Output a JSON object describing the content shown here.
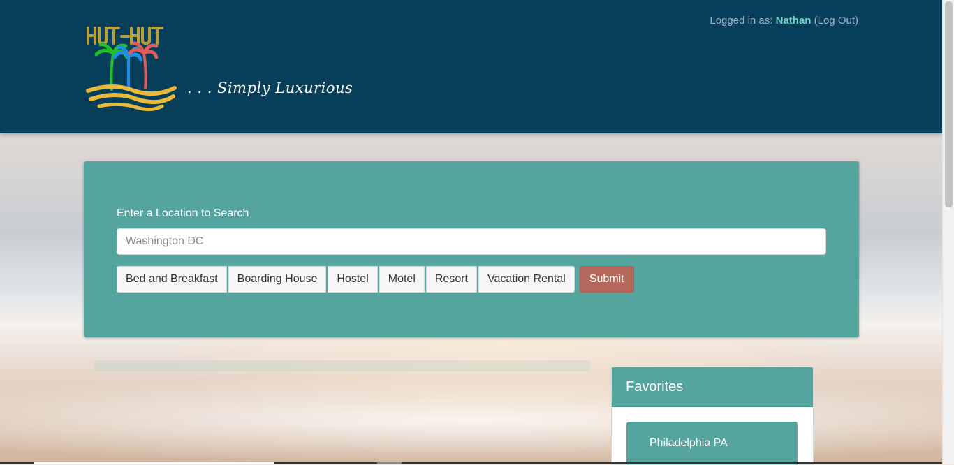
{
  "header": {
    "logo_icon": "palm-trees-logo",
    "tagline": ". . . Simply Luxurious",
    "login_prefix": "Logged in as:",
    "username": "Nathan",
    "logout_label": "(Log Out)"
  },
  "search": {
    "label": "Enter a Location to Search",
    "value": "",
    "placeholder": "Washington DC",
    "types": [
      "Bed and Breakfast",
      "Boarding House",
      "Hostel",
      "Motel",
      "Resort",
      "Vacation Rental"
    ],
    "submit_label": "Submit"
  },
  "favorites": {
    "title": "Favorites",
    "items": [
      "Philadelphia PA"
    ]
  },
  "colors": {
    "header_bg": "#073f5b",
    "panel_teal": "#55a59e",
    "submit": "#b5695c",
    "username": "#6fd1c3"
  }
}
